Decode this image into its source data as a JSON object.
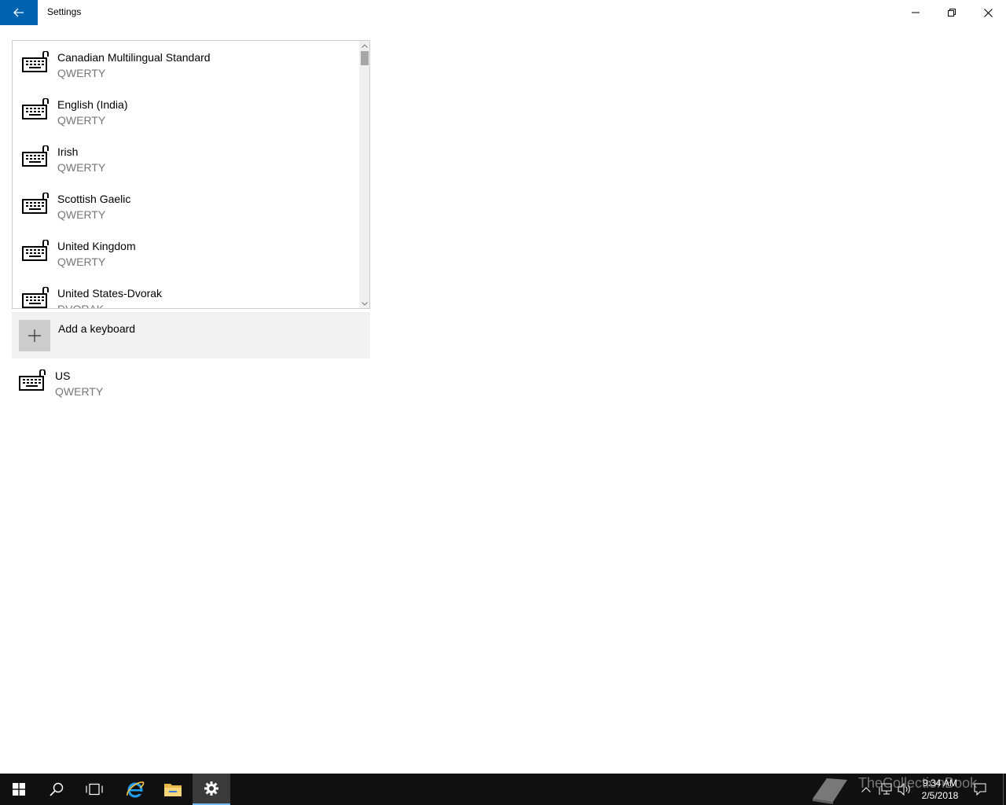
{
  "window": {
    "title": "Settings"
  },
  "keyboard_list": {
    "items": [
      {
        "name": "Canadian Multilingual Standard",
        "layout": "QWERTY"
      },
      {
        "name": "English (India)",
        "layout": "QWERTY"
      },
      {
        "name": "Irish",
        "layout": "QWERTY"
      },
      {
        "name": "Scottish Gaelic",
        "layout": "QWERTY"
      },
      {
        "name": "United Kingdom",
        "layout": "QWERTY"
      },
      {
        "name": "United States-Dvorak",
        "layout": "DVORAK"
      }
    ]
  },
  "add_keyboard": {
    "label": "Add a keyboard"
  },
  "installed_keyboard": {
    "name": "US",
    "layout": "QWERTY"
  },
  "taskbar": {
    "time": "9:34 AM",
    "date": "2/5/2018"
  },
  "watermark": {
    "text": "TheCollectionBook"
  },
  "colors": {
    "accent": "#0063b1",
    "taskbar": "#101010",
    "secondary_text": "#767676"
  }
}
